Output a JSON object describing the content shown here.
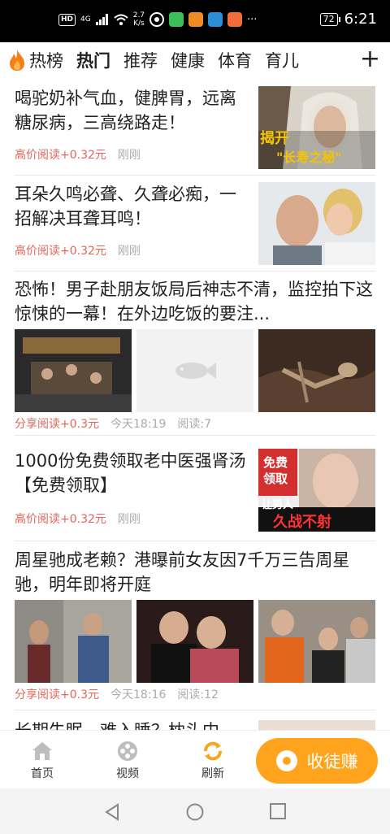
{
  "status_bar": {
    "hd": "HD",
    "signal": "4G",
    "speed_value": "2.7",
    "speed_unit": "K/s",
    "battery": "72",
    "time": "6:21",
    "overflow": "···"
  },
  "tabs": [
    {
      "label": "热榜"
    },
    {
      "label": "热门",
      "active": true
    },
    {
      "label": "推荐"
    },
    {
      "label": "健康"
    },
    {
      "label": "体育"
    },
    {
      "label": "育儿"
    }
  ],
  "tab_add": "+",
  "feed": [
    {
      "title": "喝驼奶补气血，健脾胃，远离糖尿病，三高绕路走！",
      "reward": "高价阅读+0.32元",
      "time": "刚刚",
      "image_caption_top": "揭开",
      "image_caption_bottom": "\"长寿之秘\""
    },
    {
      "title": "耳朵久鸣必聋、久聋必痴，一招解决耳聋耳鸣！",
      "reward": "高价阅读+0.32元",
      "time": "刚刚"
    },
    {
      "title": "恐怖！男子赴朋友饭局后神志不清，监控拍下这惊悚的一幕！在外边吃饭的要注...",
      "reward": "分享阅读+0.3元",
      "time": "今天18:19",
      "reads": "阅读:7"
    },
    {
      "title": "1000份免费领取老中医强肾汤【免费领取】",
      "reward": "高价阅读+0.32元",
      "time": "刚刚",
      "image_badge_1": "免费",
      "image_badge_2": "领取",
      "image_caption_1": "让男人",
      "image_caption_2": "久战不射"
    },
    {
      "title": "周星驰成老赖？港曝前女友因7千万三告周星驰，明年即将开庭",
      "reward": "分享阅读+0.3元",
      "time": "今天18:16",
      "reads": "阅读:12"
    },
    {
      "title": "长期失眠，难入睡？枕头中"
    }
  ],
  "bottom_nav": {
    "home": "首页",
    "video": "视频",
    "refresh": "刷新",
    "earn": "收徒赚"
  },
  "colors": {
    "accent": "#f9b33c",
    "earn_button": "#ffa41c",
    "reward_text": "#e0665a",
    "refresh_icon": "#f5a623"
  }
}
